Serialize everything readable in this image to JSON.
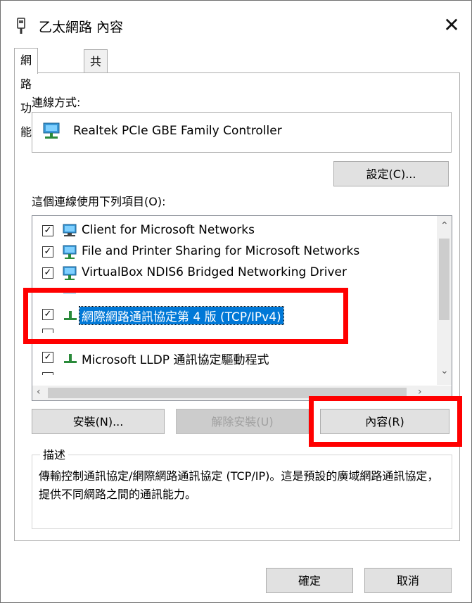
{
  "window": {
    "title": "乙太網路 內容",
    "close_symbol": "✕"
  },
  "tabs": [
    {
      "label": "網路功能",
      "active": true
    },
    {
      "label": "共用",
      "active": false
    }
  ],
  "connect_using": {
    "label": "連線方式:",
    "adapter": "Realtek PCIe GBE Family Controller",
    "configure_button": "設定(C)..."
  },
  "items_section": {
    "label": "這個連線使用下列項目(O):",
    "items": [
      {
        "label": "Client for Microsoft Networks",
        "checked": true,
        "icon": "network-client-icon"
      },
      {
        "label": "File and Printer Sharing for Microsoft Networks",
        "checked": true,
        "icon": "network-service-icon"
      },
      {
        "label": "VirtualBox NDIS6 Bridged Networking Driver",
        "checked": true,
        "icon": "network-service-icon"
      },
      {
        "label": "網際網路通訊協定第 4 版 (TCP/IPv4)",
        "checked": true,
        "icon": "protocol-icon",
        "selected": true
      },
      {
        "label": "Microsoft LLDP 通訊協定驅動程式",
        "checked": true,
        "icon": "protocol-icon"
      }
    ]
  },
  "buttons": {
    "install": "安裝(N)...",
    "uninstall": "解除安裝(U)",
    "properties": "內容(R)",
    "ok": "確定",
    "cancel": "取消"
  },
  "description": {
    "title": "描述",
    "text": "傳輸控制通訊協定/網際網路通訊協定 (TCP/IP)。這是預設的廣域網路通訊協定，提供不同網路之間的通訊能力。"
  },
  "colors": {
    "selection": "#0078d7",
    "annotation_red": "#ff0000"
  }
}
